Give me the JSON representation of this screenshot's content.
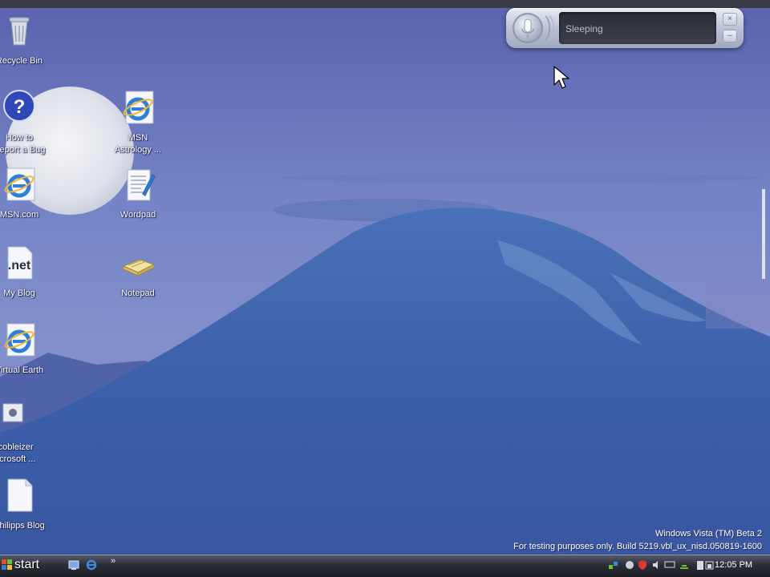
{
  "desktop": {
    "icons": [
      {
        "id": "recycle-bin",
        "label": "Recycle Bin",
        "icon": "recycle-bin-icon"
      },
      {
        "id": "report-bug",
        "label": "How to\nReport a Bug",
        "icon": "help-icon"
      },
      {
        "id": "msn-com",
        "label": "MSN.com",
        "icon": "internet-explorer-icon"
      },
      {
        "id": "my-blog",
        "label": "My Blog",
        "icon": "dotnet-icon"
      },
      {
        "id": "virtual-earth",
        "label": "Virtual Earth",
        "icon": "internet-explorer-icon"
      },
      {
        "id": "scobleizer",
        "label": "Scobleizer\nMicrosoft ...",
        "icon": "generic-app-icon"
      },
      {
        "id": "philipps-blog",
        "label": "Philipps Blog",
        "icon": "document-icon"
      },
      {
        "id": "msn-astrology",
        "label": "MSN\nAstrology ...",
        "icon": "internet-explorer-icon"
      },
      {
        "id": "wordpad",
        "label": "Wordpad",
        "icon": "wordpad-icon"
      },
      {
        "id": "notepad",
        "label": "Notepad",
        "icon": "notepad-icon"
      }
    ]
  },
  "speech_bar": {
    "status": "Sleeping",
    "icon": "microphone-icon",
    "close_icon": "close-icon",
    "minimize_icon": "minimize-icon"
  },
  "watermark": {
    "line1": "Windows Vista (TM) Beta 2",
    "line2": "For testing purposes only. Build 5219.vbl_ux_nisd.050819-1600"
  },
  "taskbar": {
    "start_label": "start",
    "quick_launch": [
      "show-desktop-icon",
      "internet-explorer-icon"
    ],
    "more_glyph": "»",
    "clock": "12:05 PM",
    "tray_icons": [
      "network-icon",
      "security-icon",
      "shield-icon",
      "volume-icon",
      "display-icon",
      "network-adapter-icon",
      "power-icon",
      "battery-icon"
    ]
  },
  "colors": {
    "sky_top": "#5d67b4",
    "sky_mid": "#7482c8",
    "mountain": "#3b5ea8",
    "taskbar": "#23262d"
  }
}
